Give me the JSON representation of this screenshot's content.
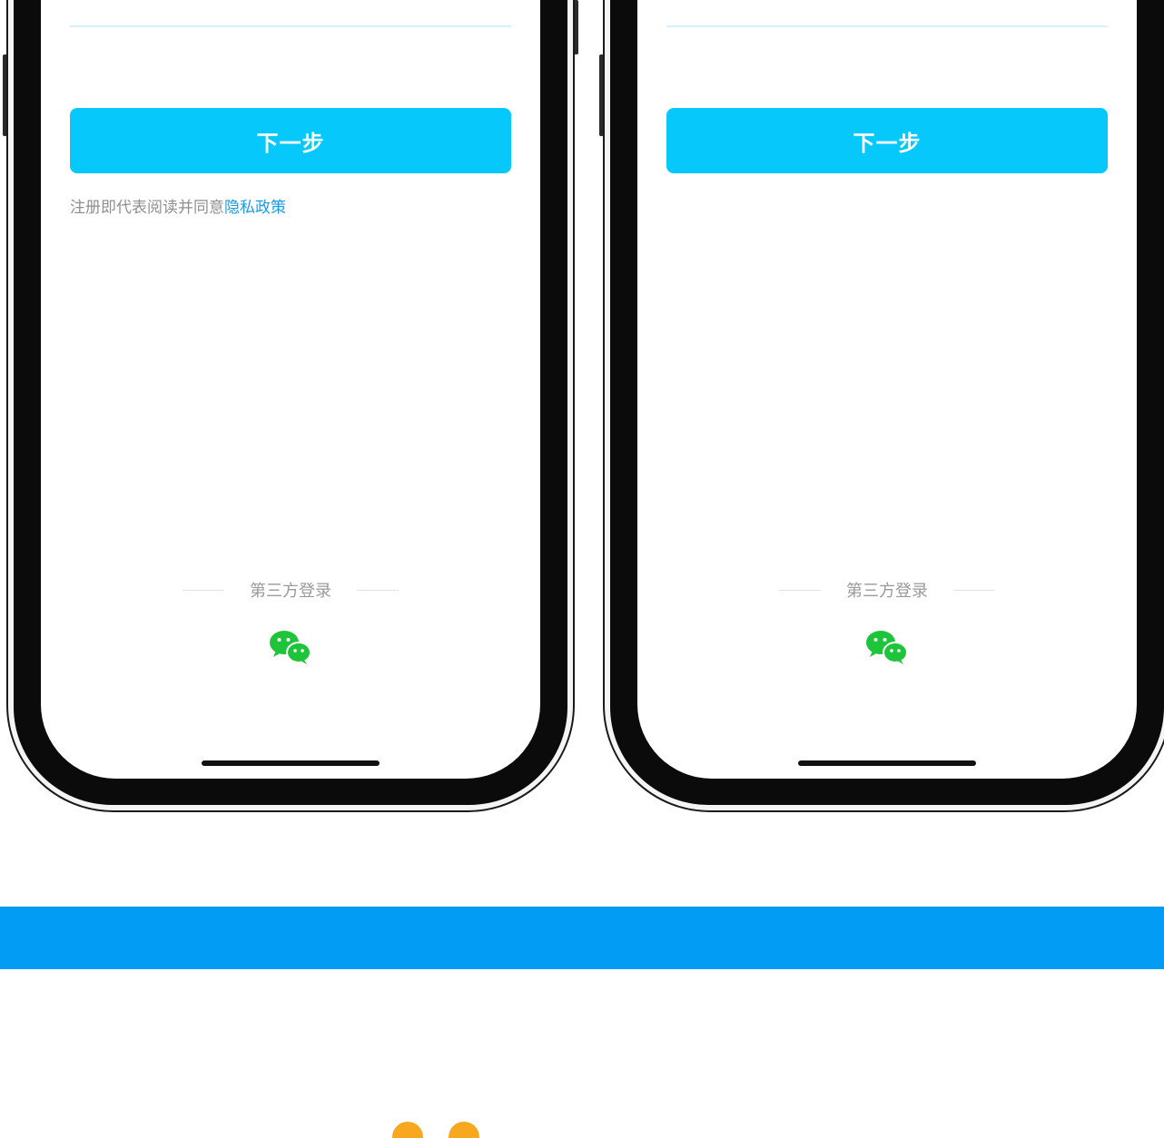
{
  "phones": [
    {
      "next_label": "下一步",
      "agreement_text": "注册即代表阅读并同意",
      "policy_link": "隐私政策",
      "third_party_label": "第三方登录"
    },
    {
      "next_label": "下一步",
      "third_party_label": "第三方登录"
    }
  ],
  "colors": {
    "button": "#06c8fb",
    "link": "#1a9be6",
    "band": "#039cf5",
    "wechat": "#1ec53a",
    "peek": "#f7a81f"
  },
  "icons": [
    "wechat-icon"
  ]
}
